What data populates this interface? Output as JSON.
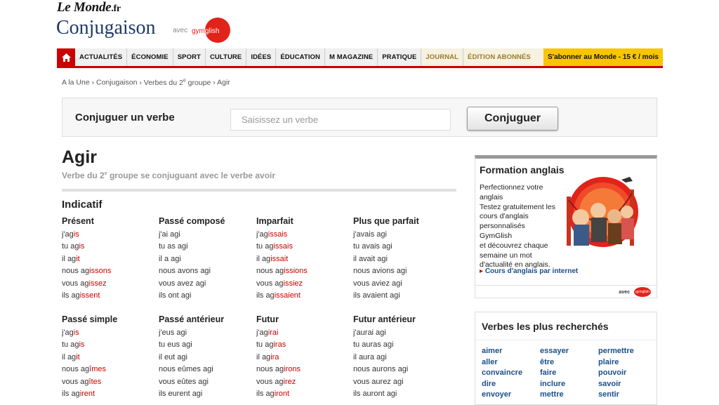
{
  "header": {
    "logo": "Le Monde",
    "logo_tld": ".fr",
    "title": "Conjugaison",
    "avec": "avec",
    "gym_part1": "gym",
    "gym_part2": "glish"
  },
  "nav": {
    "items": [
      "ACTUALITÉS",
      "ÉCONOMIE",
      "SPORT",
      "CULTURE",
      "IDÉES",
      "ÉDUCATION",
      "M MAGAZINE",
      "PRATIQUE"
    ],
    "journal": "JOURNAL",
    "edition": "ÉDITION ABONNÉS",
    "subscribe": "S'abonner au Monde - 15 € / mois"
  },
  "breadcrumb": {
    "a_la_une": "A la Une",
    "conjugaison": "Conjugaison",
    "verbes_pre": "Verbes du 2",
    "verbes_sup": "e",
    "verbes_post": " groupe",
    "current": "Agir",
    "sep": "›"
  },
  "search": {
    "label": "Conjuguer un verbe",
    "placeholder": "Saisissez un verbe",
    "button": "Conjuguer"
  },
  "verb": {
    "title": "Agir",
    "subtitle_pre": "Verbe du 2",
    "subtitle_sup": "e",
    "subtitle_post": " groupe se conjuguant avec le verbe avoir"
  },
  "mode": "Indicatif",
  "tenses": [
    {
      "name": "Présent",
      "rows": [
        [
          "j'ag",
          "is"
        ],
        [
          "tu ag",
          "is"
        ],
        [
          "il ag",
          "it"
        ],
        [
          "nous ag",
          "issons"
        ],
        [
          "vous ag",
          "issez"
        ],
        [
          "ils ag",
          "issent"
        ]
      ]
    },
    {
      "name": "Passé composé",
      "rows": [
        [
          "j'ai agi",
          ""
        ],
        [
          "tu as agi",
          ""
        ],
        [
          "il a agi",
          ""
        ],
        [
          "nous avons agi",
          ""
        ],
        [
          "vous avez agi",
          ""
        ],
        [
          "ils ont agi",
          ""
        ]
      ]
    },
    {
      "name": "Imparfait",
      "rows": [
        [
          "j'ag",
          "issais"
        ],
        [
          "tu ag",
          "issais"
        ],
        [
          "il ag",
          "issait"
        ],
        [
          "nous ag",
          "issions"
        ],
        [
          "vous ag",
          "issiez"
        ],
        [
          "ils ag",
          "issaient"
        ]
      ]
    },
    {
      "name": "Plus que parfait",
      "rows": [
        [
          "j'avais agi",
          ""
        ],
        [
          "tu avais agi",
          ""
        ],
        [
          "il avait agi",
          ""
        ],
        [
          "nous avions agi",
          ""
        ],
        [
          "vous aviez agi",
          ""
        ],
        [
          "ils avaient agi",
          ""
        ]
      ]
    },
    {
      "name": "Passé simple",
      "rows": [
        [
          "j'ag",
          "is"
        ],
        [
          "tu ag",
          "is"
        ],
        [
          "il ag",
          "it"
        ],
        [
          "nous ag",
          "îmes"
        ],
        [
          "vous ag",
          "îtes"
        ],
        [
          "ils ag",
          "irent"
        ]
      ]
    },
    {
      "name": "Passé antérieur",
      "rows": [
        [
          "j'eus agi",
          ""
        ],
        [
          "tu eus agi",
          ""
        ],
        [
          "il eut agi",
          ""
        ],
        [
          "nous eûmes agi",
          ""
        ],
        [
          "vous eûtes agi",
          ""
        ],
        [
          "ils eurent agi",
          ""
        ]
      ]
    },
    {
      "name": "Futur",
      "rows": [
        [
          "j'ag",
          "irai"
        ],
        [
          "tu ag",
          "iras"
        ],
        [
          "il ag",
          "ira"
        ],
        [
          "nous ag",
          "irons"
        ],
        [
          "vous ag",
          "irez"
        ],
        [
          "ils ag",
          "iront"
        ]
      ]
    },
    {
      "name": "Futur antérieur",
      "rows": [
        [
          "j'aurai agi",
          ""
        ],
        [
          "tu auras agi",
          ""
        ],
        [
          "il aura agi",
          ""
        ],
        [
          "nous aurons agi",
          ""
        ],
        [
          "vous aurez agi",
          ""
        ],
        [
          "ils auront agi",
          ""
        ]
      ]
    }
  ],
  "promo": {
    "title": "Formation anglais",
    "lines": [
      "Perfectionnez votre",
      "anglais",
      "Testez gratuitement les",
      "cours d'anglais",
      "personnalisés GymGlish",
      "et découvrez chaque",
      "semaine un mot",
      "d'actualité en anglais."
    ],
    "link": "Cours d'anglais par internet",
    "avec": "avec",
    "gym": "gymglish"
  },
  "popular": {
    "title": "Verbes les plus recherchés",
    "columns": [
      [
        "aimer",
        "aller",
        "convaincre",
        "dire",
        "envoyer"
      ],
      [
        "essayer",
        "être",
        "faire",
        "inclure",
        "mettre"
      ],
      [
        "permettre",
        "plaire",
        "pouvoir",
        "savoir",
        "sentir"
      ]
    ]
  },
  "colors": {
    "accent": "#cc0000",
    "link": "#1a4f8a",
    "subscribe_bg": "#f7c600"
  }
}
